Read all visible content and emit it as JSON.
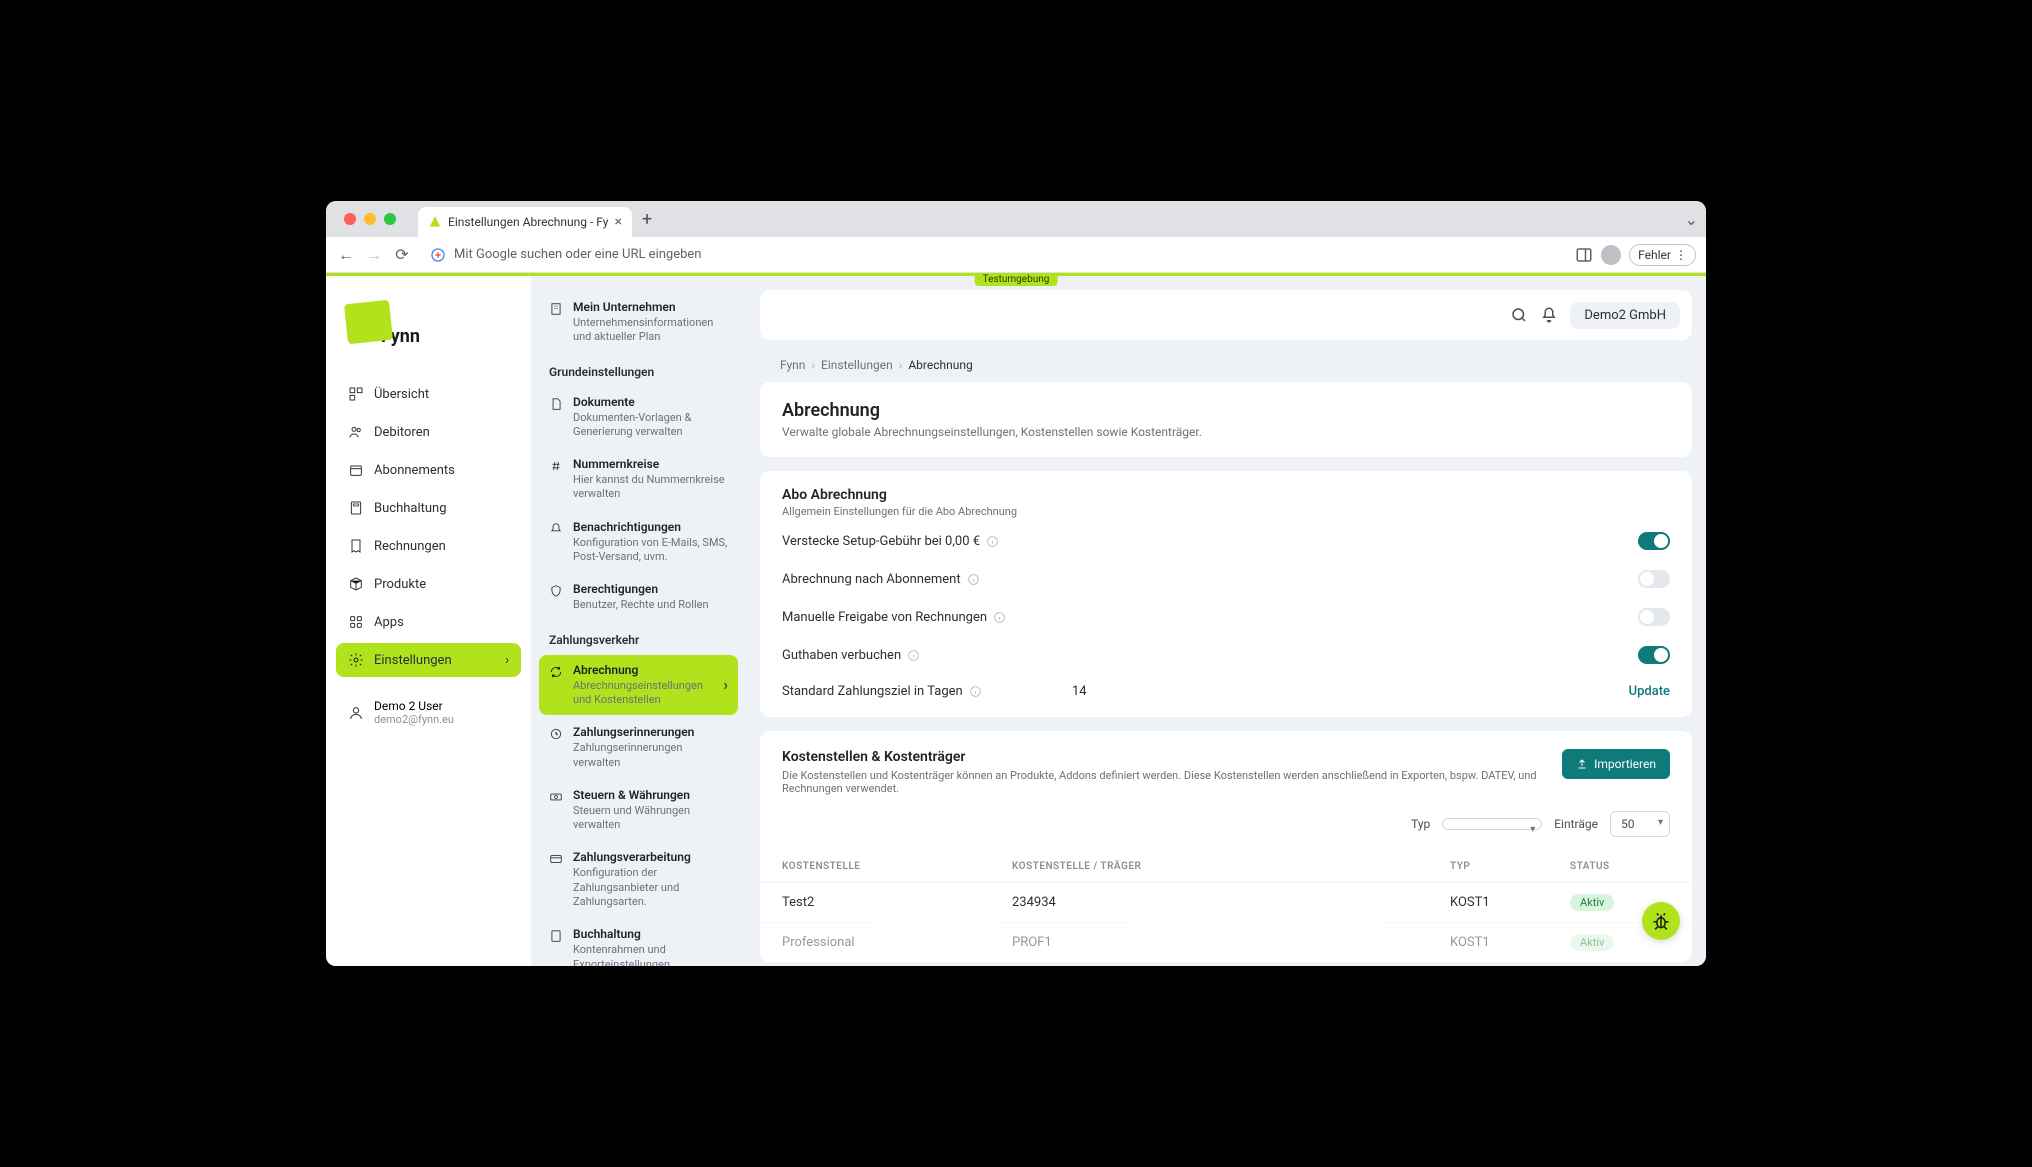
{
  "browser": {
    "tab_title": "Einstellungen Abrechnung - Fy",
    "url_placeholder": "Mit Google suchen oder eine URL eingeben",
    "error_btn": "Fehler"
  },
  "env_badge": "Testumgebung",
  "logo_text": "Fynn",
  "nav": [
    {
      "label": "Übersicht"
    },
    {
      "label": "Debitoren"
    },
    {
      "label": "Abonnements"
    },
    {
      "label": "Buchhaltung"
    },
    {
      "label": "Rechnungen"
    },
    {
      "label": "Produkte"
    },
    {
      "label": "Apps"
    },
    {
      "label": "Einstellungen"
    }
  ],
  "user": {
    "name": "Demo 2 User",
    "email": "demo2@fynn.eu"
  },
  "subnav": {
    "item_company": {
      "title": "Mein Unternehmen",
      "desc": "Unternehmensinformationen und aktueller Plan"
    },
    "sec_basic": "Grundeinstellungen",
    "item_docs": {
      "title": "Dokumente",
      "desc": "Dokumenten-Vorlagen & Generierung verwalten"
    },
    "item_numbers": {
      "title": "Nummernkreise",
      "desc": "Hier kannst du Nummernkreise verwalten"
    },
    "item_notif": {
      "title": "Benachrichtigungen",
      "desc": "Konfiguration von E-Mails, SMS, Post-Versand, uvm."
    },
    "item_perm": {
      "title": "Berechtigungen",
      "desc": "Benutzer, Rechte und Rollen"
    },
    "sec_pay": "Zahlungsverkehr",
    "item_billing": {
      "title": "Abrechnung",
      "desc": "Abrechnungseinstellungen und Kostenstellen"
    },
    "item_dunning": {
      "title": "Zahlungserinnerungen",
      "desc": "Zahlungserinnerungen verwalten"
    },
    "item_tax": {
      "title": "Steuern & Währungen",
      "desc": "Steuern und Währungen verwalten"
    },
    "item_payproc": {
      "title": "Zahlungsverarbeitung",
      "desc": "Konfiguration der Zahlungsanbieter und Zahlungsarten."
    },
    "item_acct": {
      "title": "Buchhaltung",
      "desc": "Kontenrahmen und Exporteinstellungen"
    }
  },
  "topbar": {
    "company": "Demo2 GmbH"
  },
  "breadcrumb": {
    "root": "Fynn",
    "mid": "Einstellungen",
    "cur": "Abrechnung"
  },
  "page": {
    "title": "Abrechnung",
    "subtitle": "Verwalte globale Abrechnungseinstellungen, Kostenstellen sowie Kostenträger."
  },
  "abo": {
    "title": "Abo Abrechnung",
    "subtitle": "Allgemein Einstellungen für die Abo Abrechnung",
    "setup_fee": "Verstecke Setup-Gebühr bei 0,00 €",
    "by_sub": "Abrechnung nach Abonnement",
    "manual": "Manuelle Freigabe von Rechnungen",
    "credit": "Guthaben verbuchen",
    "due": "Standard Zahlungsziel in Tagen",
    "due_val": "14",
    "update": "Update"
  },
  "cost": {
    "title": "Kostenstellen & Kostenträger",
    "subtitle": "Die Kostenstellen und Kostenträger können an Produkte, Addons definiert werden. Diese Kostenstellen werden anschließend in Exporten, bspw. DATEV, und Rechnungen verwendet.",
    "import_btn": "Importieren",
    "filter_type": "Typ",
    "filter_entries": "Einträge",
    "filter_entries_val": "50",
    "cols": {
      "c1": "KOSTENSTELLE",
      "c2": "KOSTENSTELLE / TRÄGER",
      "c3": "TYP",
      "c4": "STATUS"
    },
    "rows": [
      {
        "name": "Test2",
        "code": "234934",
        "type": "KOST1",
        "status": "Aktiv"
      },
      {
        "name": "Professional",
        "code": "PROF1",
        "type": "KOST1",
        "status": "Aktiv"
      }
    ]
  }
}
